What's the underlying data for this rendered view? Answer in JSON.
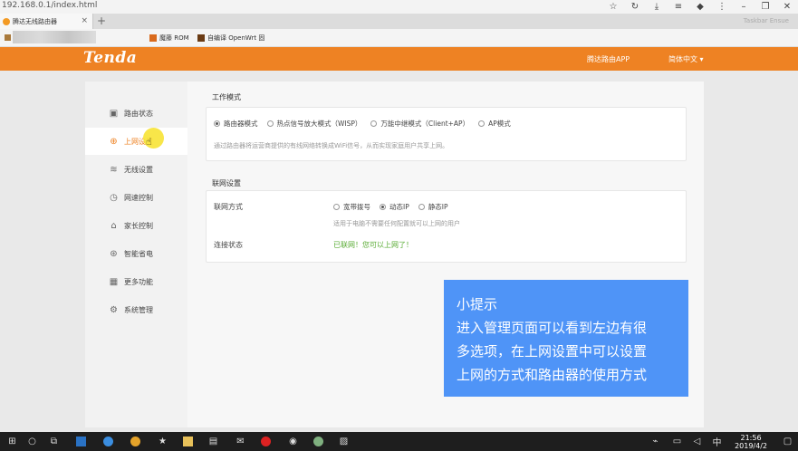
{
  "browser": {
    "address": "192.168.0.1/index.html",
    "tab_title": "腾达无线路由器",
    "tab_close": "×",
    "new_tab": "+",
    "tabbar_right": "Taskbar Ensue",
    "bookmarks": [
      "魔藤 ROM",
      "自编译 OpenWrt 固"
    ]
  },
  "header": {
    "logo": "Tenda",
    "app_link": "腾达路由APP",
    "language": "简体中文"
  },
  "sidebar": {
    "items": [
      {
        "label": "路由状态",
        "icon": "status-icon"
      },
      {
        "label": "上网设置",
        "icon": "globe-icon"
      },
      {
        "label": "无线设置",
        "icon": "wifi-icon"
      },
      {
        "label": "网速控制",
        "icon": "speed-icon"
      },
      {
        "label": "家长控制",
        "icon": "home-icon"
      },
      {
        "label": "智能省电",
        "icon": "power-icon"
      },
      {
        "label": "更多功能",
        "icon": "grid-icon"
      },
      {
        "label": "系统管理",
        "icon": "gear-icon"
      }
    ],
    "active_index": 1
  },
  "work_mode": {
    "title": "工作模式",
    "options": [
      "路由器模式",
      "热点信号放大模式（WISP）",
      "万能中继模式（Client+AP）",
      "AP模式"
    ],
    "selected": "路由器模式",
    "description": "通过路由器将运营商提供的有线网络转换成WiFi信号，从而实现家庭用户共享上网。"
  },
  "internet": {
    "title": "联网设置",
    "method_label": "联网方式",
    "methods": [
      "宽带拨号",
      "动态IP",
      "静态IP"
    ],
    "selected_method": "动态IP",
    "method_hint": "适用于电脑不需要任何配置就可以上网的用户",
    "status_label": "连接状态",
    "status_value": "已联网！您可以上网了！"
  },
  "tip": {
    "lines": [
      "小提示",
      "进入管理页面可以看到左边有很",
      "多选项，在上网设置中可以设置",
      "上网的方式和路由器的使用方式"
    ]
  },
  "taskbar": {
    "time": "21:56",
    "date": "2019/4/2"
  },
  "colors": {
    "brand": "#ee8223",
    "tip": "#4f94f7",
    "ok": "#5aac35"
  }
}
